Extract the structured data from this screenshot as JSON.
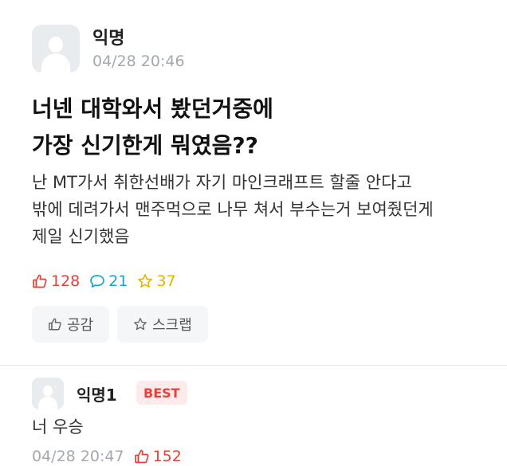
{
  "post": {
    "author": "익명",
    "time": "04/28 20:46",
    "title_lines": [
      "너넨 대학와서 봤던거중에",
      "가장 신기한게 뭐였음??"
    ],
    "content_lines": [
      "난 MT가서 취한선배가 자기 마인크래프트 할줄 안다고",
      "밖에 데려가서 맨주먹으로 나무 쳐서 부수는거 보여줬던게",
      "제일 신기했음"
    ],
    "stats": {
      "likes": "128",
      "comments": "21",
      "scraps": "37"
    },
    "actions": {
      "like_label": "공감",
      "scrap_label": "스크랩"
    }
  },
  "comment": {
    "author": "익명1",
    "badge": "BEST",
    "text": "너 우승",
    "time": "04/28 20:47",
    "likes": "152"
  },
  "colors": {
    "like": "#e0443a",
    "comment": "#1aa6c4",
    "scrap": "#e6b400",
    "meta_gray": "#a3a9b0"
  },
  "icons": [
    "avatar-placeholder-icon",
    "thumbs-up-icon",
    "speech-bubble-icon",
    "star-icon"
  ]
}
